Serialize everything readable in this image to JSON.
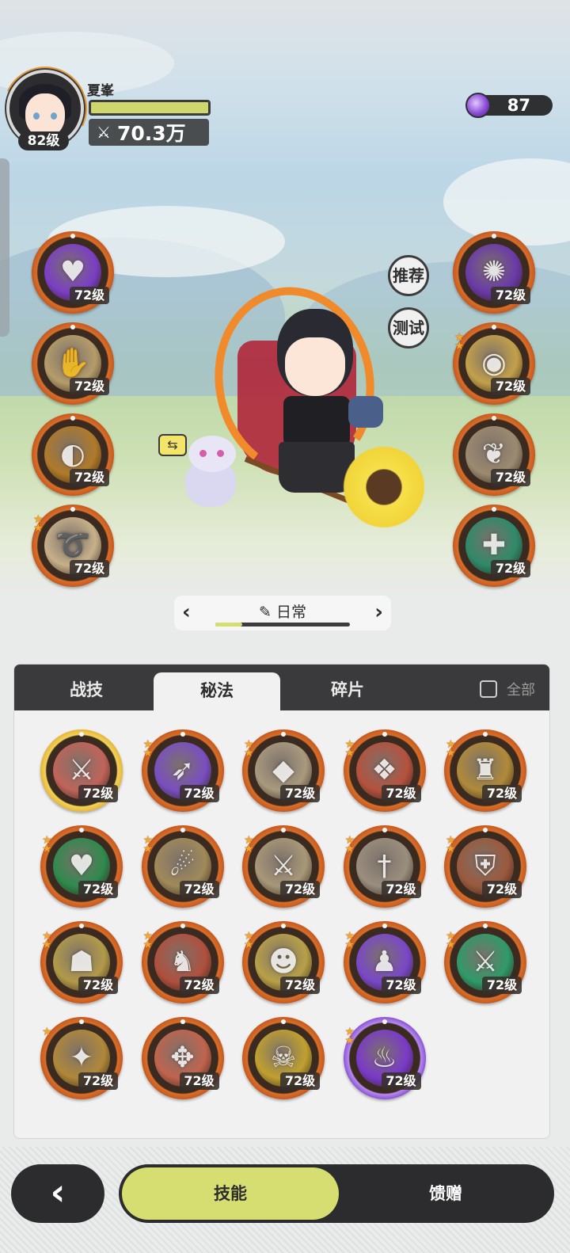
{
  "player": {
    "name": "夏峯",
    "level": "82级",
    "power": "70.3万",
    "power_icon": "crossed-swords-icon"
  },
  "currency": {
    "gem_count": "87",
    "icon": "purple-gem-icon"
  },
  "side_buttons": {
    "recommend": "推荐",
    "test": "测试"
  },
  "equipped_left": [
    {
      "level": "72级",
      "glyph": "♥",
      "color": "#7b3fc4",
      "stars": 0,
      "frame": "orange"
    },
    {
      "level": "72级",
      "glyph": "✋",
      "color": "#b59c6a",
      "stars": 0,
      "frame": "orange"
    },
    {
      "level": "72级",
      "glyph": "◐",
      "color": "#b07a2a",
      "stars": 0,
      "frame": "orange"
    },
    {
      "level": "72级",
      "glyph": "➰",
      "color": "#c7b08a",
      "stars": 2,
      "frame": "orange"
    }
  ],
  "equipped_right": [
    {
      "level": "72级",
      "glyph": "✺",
      "color": "#6a3aa8",
      "stars": 0,
      "frame": "orange"
    },
    {
      "level": "72级",
      "glyph": "◉",
      "color": "#c3a04a",
      "stars": 2,
      "frame": "orange"
    },
    {
      "level": "72级",
      "glyph": "❦",
      "color": "#9c8a70",
      "stars": 0,
      "frame": "orange"
    },
    {
      "level": "72级",
      "glyph": "✚",
      "color": "#2f8a6a",
      "stars": 0,
      "frame": "orange"
    }
  ],
  "preset": {
    "label": "日常",
    "edit_icon": "pencil-icon",
    "progress": 0.2
  },
  "tabs": [
    {
      "label": "战技",
      "active": false
    },
    {
      "label": "秘法",
      "active": true
    },
    {
      "label": "碎片",
      "active": false
    }
  ],
  "filter": {
    "label": "全部",
    "checked": false
  },
  "skills": [
    {
      "level": "72级",
      "glyph": "⚔",
      "color": "#c0645a",
      "stars": 0,
      "frame": "gold"
    },
    {
      "level": "72级",
      "glyph": "➶",
      "color": "#7a4fc0",
      "stars": 2,
      "frame": "orange"
    },
    {
      "level": "72级",
      "glyph": "◆",
      "color": "#a8997e",
      "stars": 2,
      "frame": "orange"
    },
    {
      "level": "72级",
      "glyph": "❖",
      "color": "#b5523e",
      "stars": 2,
      "frame": "orange"
    },
    {
      "level": "72级",
      "glyph": "♜",
      "color": "#b08a3a",
      "stars": 2,
      "frame": "orange"
    },
    {
      "level": "72级",
      "glyph": "♥",
      "color": "#2f8a4e",
      "stars": 2,
      "frame": "orange"
    },
    {
      "level": "72级",
      "glyph": "☄",
      "color": "#a08a5a",
      "stars": 2,
      "frame": "orange"
    },
    {
      "level": "72级",
      "glyph": "⚔",
      "color": "#a89878",
      "stars": 2,
      "frame": "orange"
    },
    {
      "level": "72级",
      "glyph": "†",
      "color": "#9a8e7e",
      "stars": 2,
      "frame": "orange"
    },
    {
      "level": "72级",
      "glyph": "⛨",
      "color": "#9a5a3e",
      "stars": 2,
      "frame": "orange"
    },
    {
      "level": "72级",
      "glyph": "☗",
      "color": "#b29a4a",
      "stars": 2,
      "frame": "orange"
    },
    {
      "level": "72级",
      "glyph": "♞",
      "color": "#b0503e",
      "stars": 2,
      "frame": "orange"
    },
    {
      "level": "72级",
      "glyph": "☻",
      "color": "#b8a048",
      "stars": 2,
      "frame": "orange"
    },
    {
      "level": "72级",
      "glyph": "♟",
      "color": "#7a48c8",
      "stars": 2,
      "frame": "orange"
    },
    {
      "level": "72级",
      "glyph": "⚔",
      "color": "#2f9a6a",
      "stars": 2,
      "frame": "orange"
    },
    {
      "level": "72级",
      "glyph": "✦",
      "color": "#b0883a",
      "stars": 1,
      "frame": "orange"
    },
    {
      "level": "72级",
      "glyph": "✥",
      "color": "#c0644e",
      "stars": 0,
      "frame": "orange"
    },
    {
      "level": "72级",
      "glyph": "☠",
      "color": "#c0a030",
      "stars": 0,
      "frame": "orange"
    },
    {
      "level": "72级",
      "glyph": "♨",
      "color": "#7a3ac8",
      "stars": 2,
      "frame": "purple"
    }
  ],
  "bottom_nav": {
    "back_icon": "chevron-left-icon",
    "back_glyph": "‹",
    "active_label": "技能",
    "other_label": "馈赠"
  }
}
